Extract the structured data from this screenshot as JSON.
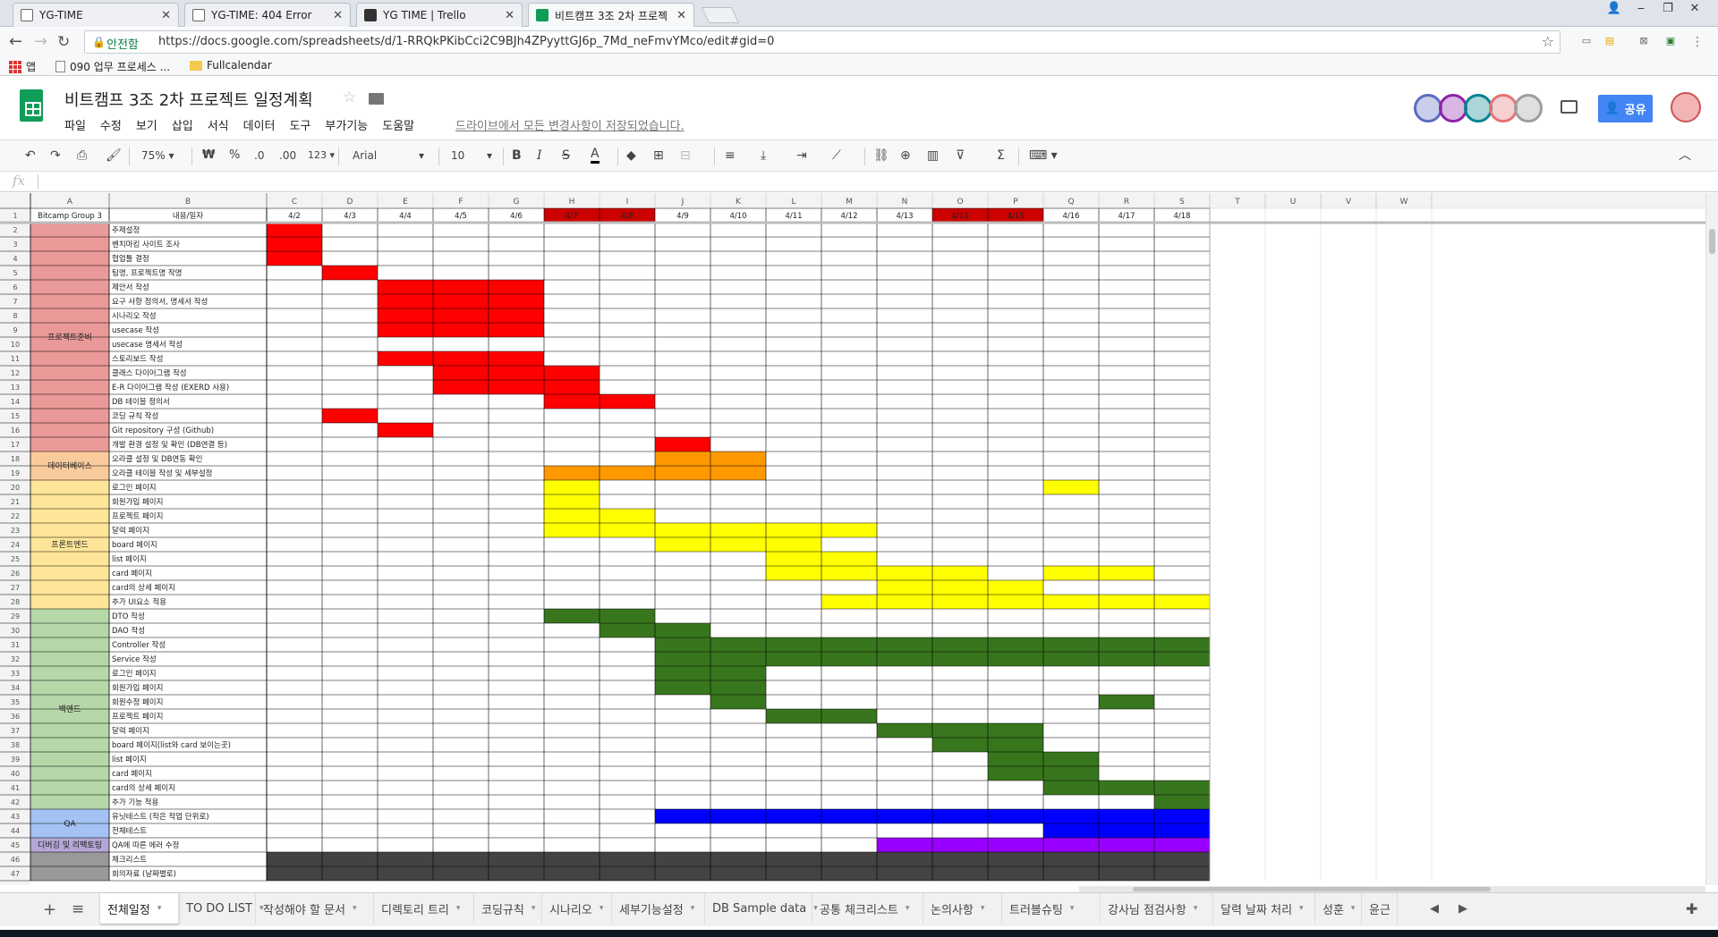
{
  "browser": {
    "tabs": [
      {
        "title": "YG-TIME",
        "icon": "page-icon"
      },
      {
        "title": "YG-TIME: 404 Error",
        "icon": "page-icon"
      },
      {
        "title": "YG TIME | Trello",
        "icon": "trello-icon"
      },
      {
        "title": "비트캠프 3조 2차 프로젝",
        "icon": "sheets-icon"
      }
    ],
    "active_tab": 3,
    "secure_label": "안전함",
    "url": "https://docs.google.com/spreadsheets/d/1-RRQkPKibCci2C9BJh4ZPyyttGJ6p_7Md_neFmvYMco/edit#gid=0",
    "bookmarks": [
      {
        "label": "앱"
      },
      {
        "label": "090 업무 프로세스 ..."
      },
      {
        "label": "Fullcalendar"
      }
    ]
  },
  "doc": {
    "title": "비트캠프 3조 2차 프로젝트 일정계획",
    "menu": [
      "파일",
      "수정",
      "보기",
      "삽입",
      "서식",
      "데이터",
      "도구",
      "부가기능",
      "도움말"
    ],
    "saved_status": "드라이브에서 모든 변경사항이 저장되었습니다.",
    "share_label": "공유",
    "avatar_colors": [
      "#5c6bc0",
      "#8e24aa",
      "#00838f",
      "#e57373",
      "#9e9e9e"
    ]
  },
  "toolbar": {
    "zoom": "75%",
    "currency": "₩",
    "percent": "%",
    "dec_decrease": ".0",
    "dec_increase": ".00",
    "format_more": "123",
    "font": "Arial",
    "font_size": "10"
  },
  "formula_bar": {
    "label": "fx",
    "value": ""
  },
  "columns": [
    "A",
    "B",
    "C",
    "D",
    "E",
    "F",
    "G",
    "H",
    "I",
    "J",
    "K",
    "L",
    "M",
    "N",
    "O",
    "P",
    "Q",
    "R",
    "S",
    "T",
    "U",
    "V",
    "W"
  ],
  "header_row": {
    "a": "Bitcamp Group 3",
    "b": "내용/일자",
    "dates": [
      "4/2",
      "4/3",
      "4/4",
      "4/5",
      "4/6",
      "4/7",
      "4/8",
      "4/9",
      "4/10",
      "4/11",
      "4/12",
      "4/13",
      "4/14",
      "4/15",
      "4/16",
      "4/17",
      "4/18"
    ],
    "weekend_indices": [
      5,
      6,
      12,
      13
    ]
  },
  "groups": [
    {
      "label": "프로젝트준비",
      "from": 2,
      "to": 17,
      "color": "#ea9999"
    },
    {
      "label": "데이터베이스",
      "from": 18,
      "to": 19,
      "color": "#f9cb9c"
    },
    {
      "label": "프론트엔드",
      "from": 20,
      "to": 28,
      "color": "#ffe599"
    },
    {
      "label": "백엔드",
      "from": 29,
      "to": 42,
      "color": "#b6d7a8"
    },
    {
      "label": "QA",
      "from": 43,
      "to": 44,
      "color": "#a4c2f4"
    },
    {
      "label": "디버깅 및 리팩토링",
      "from": 45,
      "to": 45,
      "color": "#b4a7d6"
    },
    {
      "label": "",
      "from": 46,
      "to": 47,
      "color": "#999999"
    }
  ],
  "tasks": [
    {
      "row": 2,
      "label": "주제설정",
      "color": "#ff0000",
      "cols": [
        0
      ]
    },
    {
      "row": 3,
      "label": "벤치마킹 사이트 조사",
      "color": "#ff0000",
      "cols": [
        0
      ]
    },
    {
      "row": 4,
      "label": "협업툴 결정",
      "color": "#ff0000",
      "cols": [
        0
      ]
    },
    {
      "row": 5,
      "label": "팀명, 프로젝트명 작명",
      "color": "#ff0000",
      "cols": [
        1
      ]
    },
    {
      "row": 6,
      "label": "제안서 작성",
      "color": "#ff0000",
      "cols": [
        2,
        3,
        4
      ]
    },
    {
      "row": 7,
      "label": "요구 사항 정의서, 명세서 작성",
      "color": "#ff0000",
      "cols": [
        2,
        3,
        4
      ]
    },
    {
      "row": 8,
      "label": "시나리오 작성",
      "color": "#ff0000",
      "cols": [
        2,
        3,
        4
      ]
    },
    {
      "row": 9,
      "label": "usecase 작성",
      "color": "#ff0000",
      "cols": [
        2,
        3,
        4
      ]
    },
    {
      "row": 10,
      "label": "usecase 명세서 작성",
      "color": "#ff0000",
      "cols": []
    },
    {
      "row": 11,
      "label": "스토리보드 작성",
      "color": "#ff0000",
      "cols": [
        2,
        3,
        4
      ]
    },
    {
      "row": 12,
      "label": "클래스 다이어그램 작성",
      "color": "#ff0000",
      "cols": [
        3,
        4,
        5
      ]
    },
    {
      "row": 13,
      "label": "E-R 다이어그램 작성 (EXERD 사용)",
      "color": "#ff0000",
      "cols": [
        3,
        4,
        5
      ]
    },
    {
      "row": 14,
      "label": "DB 테이블 정의서",
      "color": "#ff0000",
      "cols": [
        5,
        6
      ]
    },
    {
      "row": 15,
      "label": "코딩 규칙 작성",
      "color": "#ff0000",
      "cols": [
        1
      ]
    },
    {
      "row": 16,
      "label": "Git repository 구성 (Github)",
      "color": "#ff0000",
      "cols": [
        2
      ]
    },
    {
      "row": 17,
      "label": "개발 환경 설정 및 확인 (DB연결 등)",
      "color": "#ff0000",
      "cols": [
        7
      ]
    },
    {
      "row": 18,
      "label": "오라클 설정 및 DB연동 확인",
      "color": "#ff9900",
      "cols": [
        7,
        8
      ]
    },
    {
      "row": 19,
      "label": "오라클 테이블 작성 및 세부설정",
      "color": "#ff9900",
      "cols": [
        5,
        6,
        7,
        8
      ]
    },
    {
      "row": 20,
      "label": "로그인 페이지",
      "color": "#ffff00",
      "cols": [
        5,
        14
      ]
    },
    {
      "row": 21,
      "label": "회원가입 페이지",
      "color": "#ffff00",
      "cols": [
        5
      ]
    },
    {
      "row": 22,
      "label": "프로젝트 페이지",
      "color": "#ffff00",
      "cols": [
        5,
        6
      ]
    },
    {
      "row": 23,
      "label": "달력 페이지",
      "color": "#ffff00",
      "cols": [
        5,
        6,
        7,
        8,
        9,
        10
      ]
    },
    {
      "row": 24,
      "label": "board 페이지",
      "color": "#ffff00",
      "cols": [
        7,
        8,
        9
      ]
    },
    {
      "row": 25,
      "label": "list 페이지",
      "color": "#ffff00",
      "cols": [
        9,
        10
      ]
    },
    {
      "row": 26,
      "label": "card 페이지",
      "color": "#ffff00",
      "cols": [
        9,
        10,
        11,
        12,
        14,
        15
      ]
    },
    {
      "row": 27,
      "label": "card의 상세 페이지",
      "color": "#ffff00",
      "cols": [
        11,
        12,
        13
      ]
    },
    {
      "row": 28,
      "label": "추가 UI요소 적용",
      "color": "#ffff00",
      "cols": [
        10,
        11,
        12,
        13,
        14,
        15,
        16
      ]
    },
    {
      "row": 29,
      "label": "DTO 작성",
      "color": "#38761d",
      "cols": [
        5,
        6
      ]
    },
    {
      "row": 30,
      "label": "DAO 작성",
      "color": "#38761d",
      "cols": [
        6,
        7
      ]
    },
    {
      "row": 31,
      "label": "Controller 작성",
      "color": "#38761d",
      "cols": [
        7,
        8,
        9,
        10,
        11,
        12,
        13,
        14,
        15,
        16
      ]
    },
    {
      "row": 32,
      "label": "Service 작성",
      "color": "#38761d",
      "cols": [
        7,
        8,
        9,
        10,
        11,
        12,
        13,
        14,
        15,
        16
      ]
    },
    {
      "row": 33,
      "label": "로그인 페이지",
      "color": "#38761d",
      "cols": [
        7,
        8
      ]
    },
    {
      "row": 34,
      "label": "회원가입 페이지",
      "color": "#38761d",
      "cols": [
        7,
        8
      ]
    },
    {
      "row": 35,
      "label": "회원수정 페이지",
      "color": "#38761d",
      "cols": [
        8,
        15
      ]
    },
    {
      "row": 36,
      "label": "프로젝트 페이지",
      "color": "#38761d",
      "cols": [
        9,
        10
      ]
    },
    {
      "row": 37,
      "label": "달력 페이지",
      "color": "#38761d",
      "cols": [
        11,
        12,
        13
      ]
    },
    {
      "row": 38,
      "label": "board 페이지(list와 card 보이는곳)",
      "color": "#38761d",
      "cols": [
        12,
        13
      ]
    },
    {
      "row": 39,
      "label": "list 페이지",
      "color": "#38761d",
      "cols": [
        13,
        14
      ]
    },
    {
      "row": 40,
      "label": "card 페이지",
      "color": "#38761d",
      "cols": [
        13,
        14
      ]
    },
    {
      "row": 41,
      "label": "card의 상세 페이지",
      "color": "#38761d",
      "cols": [
        14,
        15,
        16
      ]
    },
    {
      "row": 42,
      "label": "추가 기능 적용",
      "color": "#38761d",
      "cols": [
        16
      ]
    },
    {
      "row": 43,
      "label": "유닛테스트 (작은 작업 단위로)",
      "color": "#0000ff",
      "cols": [
        7,
        8,
        9,
        10,
        11,
        12,
        13,
        14,
        15,
        16
      ]
    },
    {
      "row": 44,
      "label": "전체테스트",
      "color": "#0000ff",
      "cols": [
        14,
        15,
        16
      ]
    },
    {
      "row": 45,
      "label": "QA에 따른 에러 수정",
      "color": "#9900ff",
      "cols": [
        11,
        12,
        13,
        14,
        15,
        16
      ]
    },
    {
      "row": 46,
      "label": "체크리스트",
      "color": "#434343",
      "cols": [
        0,
        1,
        2,
        3,
        4,
        5,
        6,
        7,
        8,
        9,
        10,
        11,
        12,
        13,
        14,
        15,
        16
      ]
    },
    {
      "row": 47,
      "label": "회의자료 (날짜별로)",
      "color": "#434343",
      "cols": [
        0,
        1,
        2,
        3,
        4,
        5,
        6,
        7,
        8,
        9,
        10,
        11,
        12,
        13,
        14,
        15,
        16
      ]
    }
  ],
  "sheet_tabs": [
    "전체일정",
    "TO DO LIST",
    "작성해야 할 문서",
    "디렉토리 트리",
    "코딩규칙",
    "시나리오",
    "세부기능설정",
    "DB Sample data",
    "공통 체크리스트",
    "논의사항",
    "트러블슈팅",
    "강사님 점검사항",
    "달력 날짜 처리",
    "성훈",
    "윤근"
  ],
  "colors": {
    "weekend_header": "#cc0000",
    "grid_line": "#d9d9d9",
    "accent": "#0f9d58",
    "share_button": "#4285f4"
  }
}
